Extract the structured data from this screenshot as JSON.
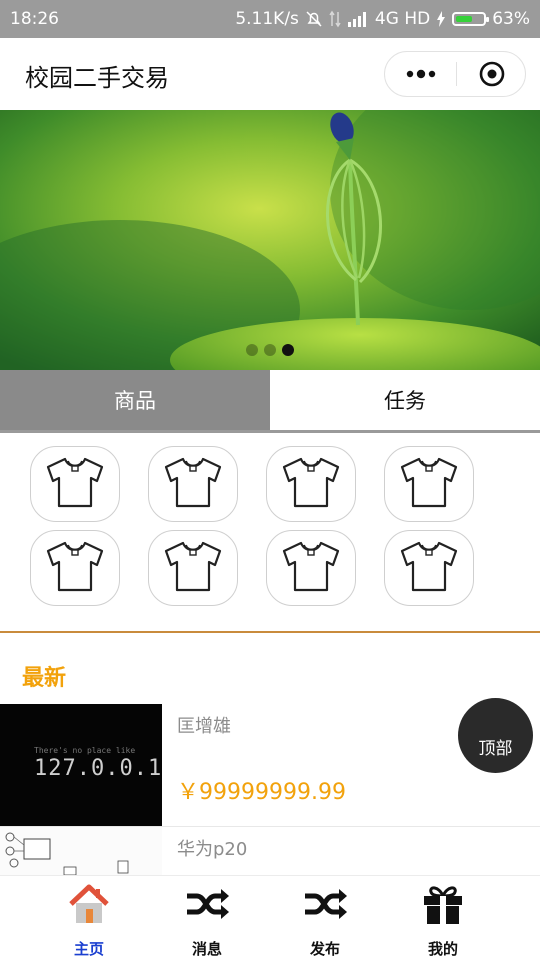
{
  "status_bar": {
    "time": "18:26",
    "network_speed": "5.11K/s",
    "network_type": "4G HD",
    "battery": "63%",
    "battery_level": 0.63
  },
  "nav": {
    "title": "校园二手交易",
    "more_icon": "more-dots-icon",
    "close_icon": "target-circle-icon"
  },
  "banner": {
    "dots_count": 3,
    "active_dot": 2
  },
  "tabs": [
    {
      "label": "商品",
      "active": true
    },
    {
      "label": "任务",
      "active": false
    }
  ],
  "categories": [
    {
      "icon": "tshirt-icon"
    },
    {
      "icon": "tshirt-icon"
    },
    {
      "icon": "tshirt-icon"
    },
    {
      "icon": "tshirt-icon"
    },
    {
      "icon": "tshirt-icon"
    },
    {
      "icon": "tshirt-icon"
    },
    {
      "icon": "tshirt-icon"
    },
    {
      "icon": "tshirt-icon"
    }
  ],
  "latest": {
    "title": "最新",
    "items": [
      {
        "name": "匡增雄",
        "price": "￥99999999.99",
        "thumb_text_small": "There's no place like",
        "thumb_text_big": "127.0.0.1"
      },
      {
        "name": "华为p20"
      }
    ]
  },
  "top_button": "顶部",
  "tabbar": [
    {
      "label": "主页",
      "icon": "home-icon",
      "active": true
    },
    {
      "label": "消息",
      "icon": "shuffle-icon",
      "active": false
    },
    {
      "label": "发布",
      "icon": "shuffle-icon",
      "active": false
    },
    {
      "label": "我的",
      "icon": "gift-icon",
      "active": false
    }
  ],
  "colors": {
    "accent": "#f2a20c",
    "tab_active_bg": "#8a8a8a",
    "tabbar_active": "#1a3fd0"
  }
}
